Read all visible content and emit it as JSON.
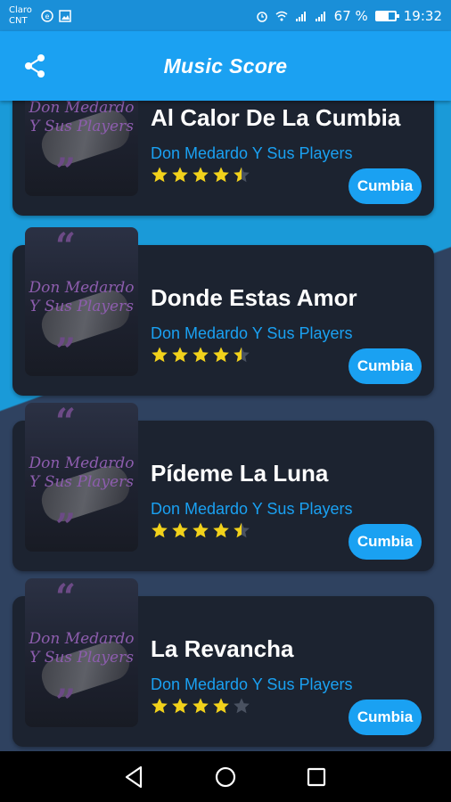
{
  "status": {
    "carrier_line1": "Claro",
    "carrier_line2": "CNT",
    "battery": "67 %",
    "battery_level": 0.67,
    "time": "19:32"
  },
  "app": {
    "title": "Music Score",
    "accent_color": "#1aa1f2"
  },
  "songs": [
    {
      "title": "Al Calor De La Cumbia",
      "artist": "Don Medardo Y Sus Players",
      "rating": 4.5,
      "genre": "Cumbia",
      "cover_text": "Don Medardo Y Sus Players"
    },
    {
      "title": "Donde Estas Amor",
      "artist": "Don Medardo Y Sus Players",
      "rating": 4.5,
      "genre": "Cumbia",
      "cover_text": "Don Medardo Y Sus Players"
    },
    {
      "title": "Pídeme La Luna",
      "artist": "Don Medardo Y Sus Players",
      "rating": 4.5,
      "genre": "Cumbia",
      "cover_text": "Don Medardo Y Sus Players"
    },
    {
      "title": "La Revancha",
      "artist": "Don Medardo Y Sus Players",
      "rating": 4,
      "genre": "Cumbia",
      "cover_text": "Don Medardo Y Sus Players"
    }
  ],
  "icons": {
    "share": "share-icon",
    "back": "back-triangle-icon",
    "home": "home-circle-icon",
    "recents": "recents-square-icon"
  }
}
